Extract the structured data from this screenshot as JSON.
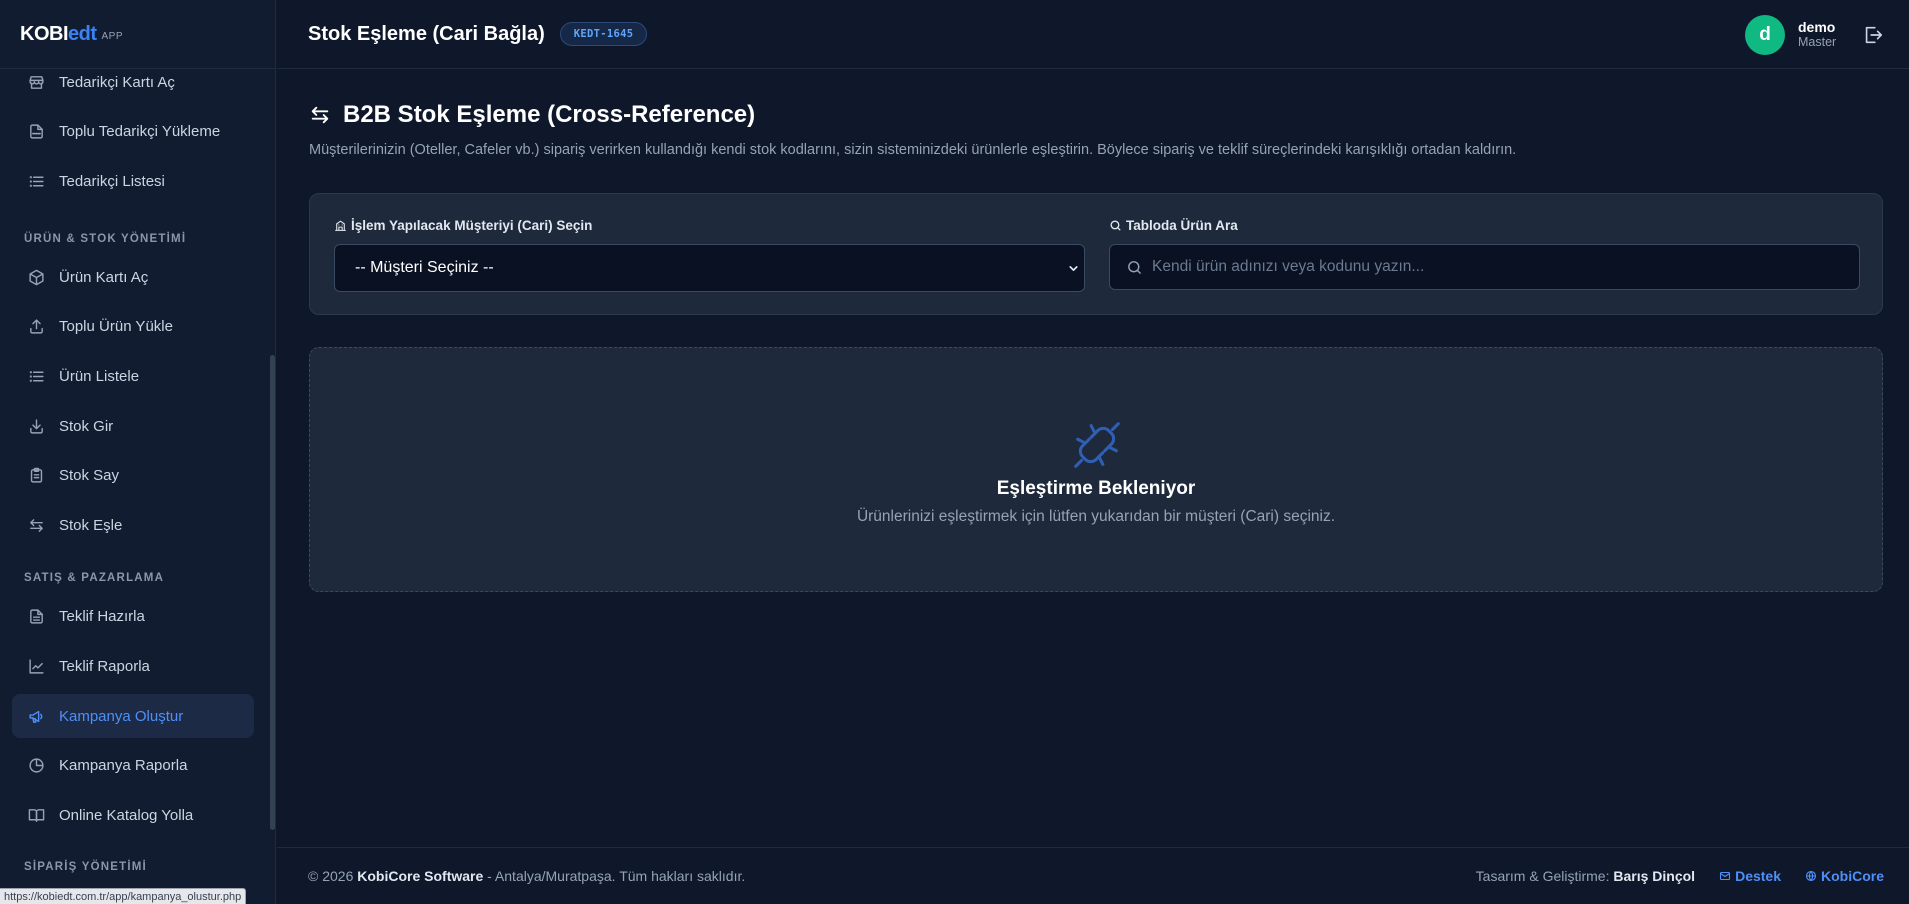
{
  "brand": {
    "part1": "KOBI",
    "part2": "edt",
    "suffix": "APP"
  },
  "sidebar": {
    "items": [
      {
        "label": "Tedarikçi Kartı Aç"
      },
      {
        "label": "Toplu Tedarikçi Yükleme"
      },
      {
        "label": "Tedarikçi Listesi"
      },
      {
        "label": "Ürün Kartı Aç"
      },
      {
        "label": "Toplu Ürün Yükle"
      },
      {
        "label": "Ürün Listele"
      },
      {
        "label": "Stok Gir"
      },
      {
        "label": "Stok Say"
      },
      {
        "label": "Stok Eşle"
      },
      {
        "label": "Teklif Hazırla"
      },
      {
        "label": "Teklif Raporla"
      },
      {
        "label": "Kampanya Oluştur"
      },
      {
        "label": "Kampanya Raporla"
      },
      {
        "label": "Online Katalog Yolla"
      }
    ],
    "sections": {
      "product": "ÜRÜN & STOK YÖNETİMİ",
      "sales": "SATIŞ & PAZARLAMA",
      "orders": "SİPARİŞ YÖNETİMİ"
    }
  },
  "status_url": "https://kobiedt.com.tr/app/kampanya_olustur.php",
  "header": {
    "title": "Stok Eşleme (Cari Bağla)",
    "badge": "KEDT-1645",
    "user_initial": "d",
    "user_name": "demo",
    "user_role": "Master"
  },
  "main": {
    "title": "B2B Stok Eşleme (Cross-Reference)",
    "description": "Müşterilerinizin (Oteller, Cafeler vb.) sipariş verirken kullandığı kendi stok kodlarını, sizin sisteminizdeki ürünlerle eşleştirin. Böylece sipariş ve teklif süreçlerindeki karışıklığı ortadan kaldırın.",
    "customer_label": "İşlem Yapılacak Müşteriyi (Cari) Seçin",
    "customer_selected": "-- Müşteri Seçiniz --",
    "search_label": "Tabloda Ürün Ara",
    "search_placeholder": "Kendi ürün adınızı veya kodunu yazın...",
    "empty_title": "Eşleştirme Bekleniyor",
    "empty_desc": "Ürünlerinizi eşleştirmek için lütfen yukarıdan bir müşteri (Cari) seçiniz."
  },
  "footer": {
    "copyright_prefix": "© 2026",
    "company": "KobiCore Software",
    "copyright_suffix": "- Antalya/Muratpaşa. Tüm hakları saklıdır.",
    "design_label": "Tasarım & Geliştirme:",
    "designer": "Barış Dinçol",
    "support_link": "Destek",
    "site_link": "KobiCore"
  },
  "colors": {
    "accent": "#3b82f6",
    "avatar": "#10b981",
    "background": "#0f172a",
    "card": "#1e293b"
  },
  "icons": {
    "brand": "none",
    "page_title": "arrows-swap-icon",
    "empty_state": "plug-disconnected-icon"
  }
}
